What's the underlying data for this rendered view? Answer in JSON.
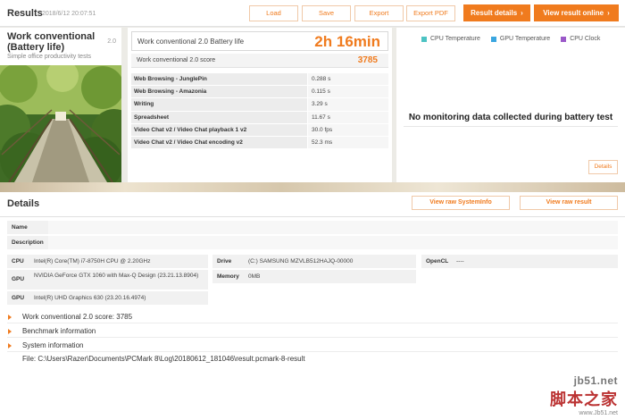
{
  "toolbar": {
    "title": "Results",
    "date": "2018/6/12 20:07:51",
    "load": "Load",
    "save": "Save",
    "export": "Export",
    "export_pdf": "Export PDF",
    "result_details": "Result details",
    "view_online": "View result online",
    "chevron": "›"
  },
  "hero": {
    "name": "Work conventional (Battery life)",
    "version": "2.0",
    "subtitle": "Simple office productivity tests"
  },
  "score": {
    "battery_label": "Work conventional 2.0 Battery life",
    "battery_value": "2h 16min",
    "score_label": "Work conventional 2.0 score",
    "score_value": "3785",
    "subtests": [
      {
        "name": "Web Browsing - JunglePin",
        "value": "0.288 s"
      },
      {
        "name": "Web Browsing - Amazonia",
        "value": "0.115 s"
      },
      {
        "name": "Writing",
        "value": "3.29 s"
      },
      {
        "name": "Spreadsheet",
        "value": "11.67 s"
      },
      {
        "name": "Video Chat v2 / Video Chat playback 1 v2",
        "value": "30.0 fps"
      },
      {
        "name": "Video Chat v2 / Video Chat encoding v2",
        "value": "52.3 ms"
      }
    ]
  },
  "monitor": {
    "legend": [
      {
        "label": "CPU Temperature",
        "color": "#4dc3c3"
      },
      {
        "label": "GPU Temperature",
        "color": "#3aa6e0"
      },
      {
        "label": "CPU Clock",
        "color": "#9b59c9"
      }
    ],
    "message": "No monitoring data collected during battery test",
    "details_button": "Details"
  },
  "details": {
    "title": "Details",
    "view_sysinfo": "View raw SystemInfo",
    "view_result": "View raw result",
    "name_label": "Name",
    "description_label": "Description",
    "hardware": {
      "cpu_label": "CPU",
      "cpu_value": "Intel(R) Core(TM) i7-8750H CPU @ 2.20GHz",
      "gpu1_label": "GPU",
      "gpu1_value": "NVIDIA GeForce GTX 1060 with Max-Q Design (23.21.13.8904)",
      "gpu2_label": "GPU",
      "gpu2_value": "Intel(R) UHD Graphics 630 (23.20.16.4974)",
      "drive_label": "Drive",
      "drive_value": "(C:) SAMSUNG MZVLB512HAJQ-00000",
      "memory_label": "Memory",
      "memory_value": "0MB",
      "opencl_label": "OpenCL",
      "opencl_value": "----"
    },
    "sections": [
      {
        "label": "Work conventional 2.0 score: 3785"
      },
      {
        "label": "Benchmark information"
      },
      {
        "label": "System information"
      }
    ],
    "file": "File: C:\\Users\\Razer\\Documents\\PCMark 8\\Log\\20180612_181046\\result.pcmark-8-result"
  },
  "watermark": {
    "site": "jb51.net",
    "brand": "脚本之家",
    "url": "www.Jb51.net"
  }
}
